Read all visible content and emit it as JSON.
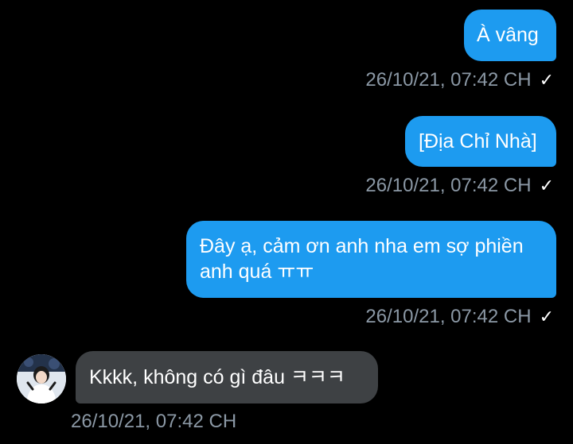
{
  "messages": [
    {
      "direction": "out",
      "text": "À vâng",
      "time": "26/10/21, 07:42 CH",
      "status_icon": "checkmark-icon"
    },
    {
      "direction": "out",
      "text": "[Địa Chỉ Nhà]",
      "time": "26/10/21, 07:42 CH",
      "status_icon": "checkmark-icon"
    },
    {
      "direction": "out",
      "line1": "Đây ạ, cảm ơn anh nha em sợ phiền",
      "line2": "anh quá ㅠㅠ",
      "time": "26/10/21, 07:42 CH",
      "status_icon": "checkmark-icon"
    },
    {
      "direction": "in",
      "text": "Kkkk, không có gì đâu ㅋㅋㅋ",
      "time": "26/10/21, 07:42 CH",
      "avatar": "avatar-icon"
    }
  ],
  "colors": {
    "background": "#000000",
    "outgoing_bubble": "#1d9bf0",
    "incoming_bubble": "#3e4144",
    "timestamp": "#8b98a5",
    "text": "#ffffff"
  },
  "check_glyph": "✓"
}
